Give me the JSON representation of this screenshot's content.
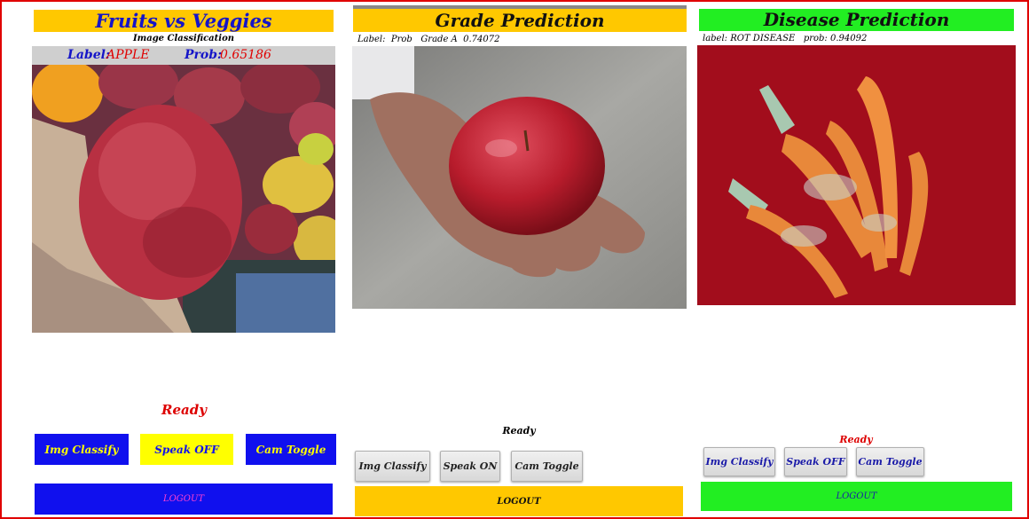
{
  "panel1": {
    "title": "Fruits vs Veggies",
    "subtitle": "Image Classification",
    "label_key": "Label:",
    "label_value": "APPLE",
    "prob_key": "Prob:",
    "prob_value": "0.65186",
    "status": "Ready",
    "buttons": {
      "classify": "Img Classify",
      "speak": "Speak OFF",
      "cam": "Cam Toggle",
      "logout": "LOGOUT"
    },
    "colors": {
      "header": "#ffc800",
      "buttons": "#1010ee",
      "speak": "#ffff00",
      "status": "#dd0000"
    }
  },
  "panel2": {
    "title": "Grade Prediction",
    "info": "Label:  Prob   Grade A  0.74072",
    "status": "Ready",
    "buttons": {
      "classify": "Img Classify",
      "speak": "Speak ON",
      "cam": "Cam Toggle",
      "logout": "LOGOUT"
    },
    "colors": {
      "header": "#ffc800",
      "logout": "#ffc800"
    }
  },
  "panel3": {
    "title": "Disease Prediction",
    "info": "label: ROT DISEASE   prob: 0.94092",
    "status": "Ready",
    "buttons": {
      "classify": "Img Classify",
      "speak": "Speak OFF",
      "cam": "Cam Toggle",
      "logout": "LOGOUT"
    },
    "colors": {
      "header": "#22ee22",
      "logout": "#22ee22",
      "button_text": "#1a1aa8"
    }
  }
}
